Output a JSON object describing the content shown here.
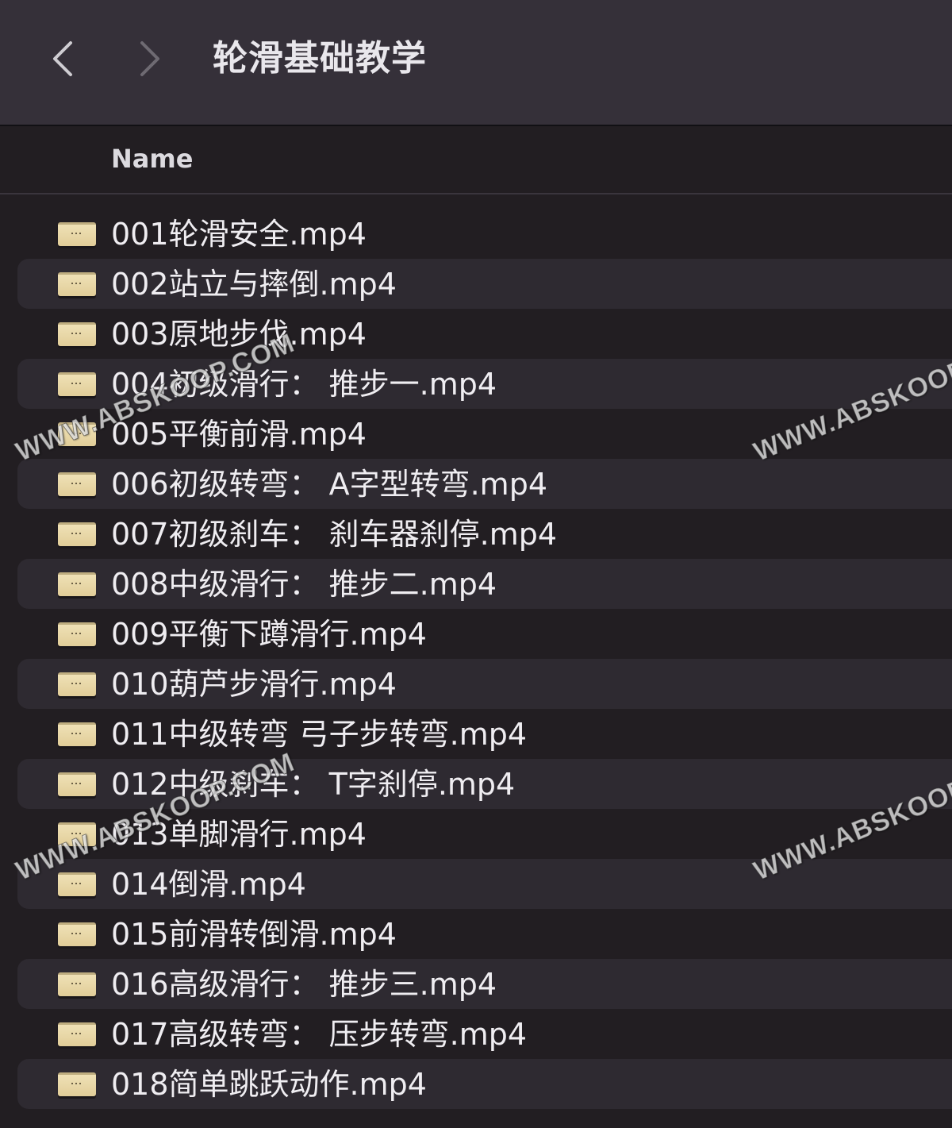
{
  "window": {
    "title": "轮滑基础教学"
  },
  "toolbar": {
    "back_icon": "chevron-left-icon",
    "forward_icon": "chevron-right-icon"
  },
  "columns": {
    "name": "Name"
  },
  "files": [
    {
      "name": "001轮滑安全.mp4"
    },
    {
      "name": "002站立与摔倒.mp4"
    },
    {
      "name": "003原地步伐.mp4"
    },
    {
      "name": "004初级滑行： 推步一.mp4"
    },
    {
      "name": "005平衡前滑.mp4"
    },
    {
      "name": "006初级转弯： A字型转弯.mp4"
    },
    {
      "name": "007初级刹车： 刹车器刹停.mp4"
    },
    {
      "name": "008中级滑行： 推步二.mp4"
    },
    {
      "name": "009平衡下蹲滑行.mp4"
    },
    {
      "name": "010葫芦步滑行.mp4"
    },
    {
      "name": "011中级转弯 弓子步转弯.mp4"
    },
    {
      "name": "012中级刹车： T字刹停.mp4"
    },
    {
      "name": "013单脚滑行.mp4"
    },
    {
      "name": "014倒滑.mp4"
    },
    {
      "name": "015前滑转倒滑.mp4"
    },
    {
      "name": "016高级滑行： 推步三.mp4"
    },
    {
      "name": "017高级转弯： 压步转弯.mp4"
    },
    {
      "name": "018简单跳跃动作.mp4"
    }
  ],
  "watermark": {
    "text": "WWW.ABSKOOP.COM"
  }
}
